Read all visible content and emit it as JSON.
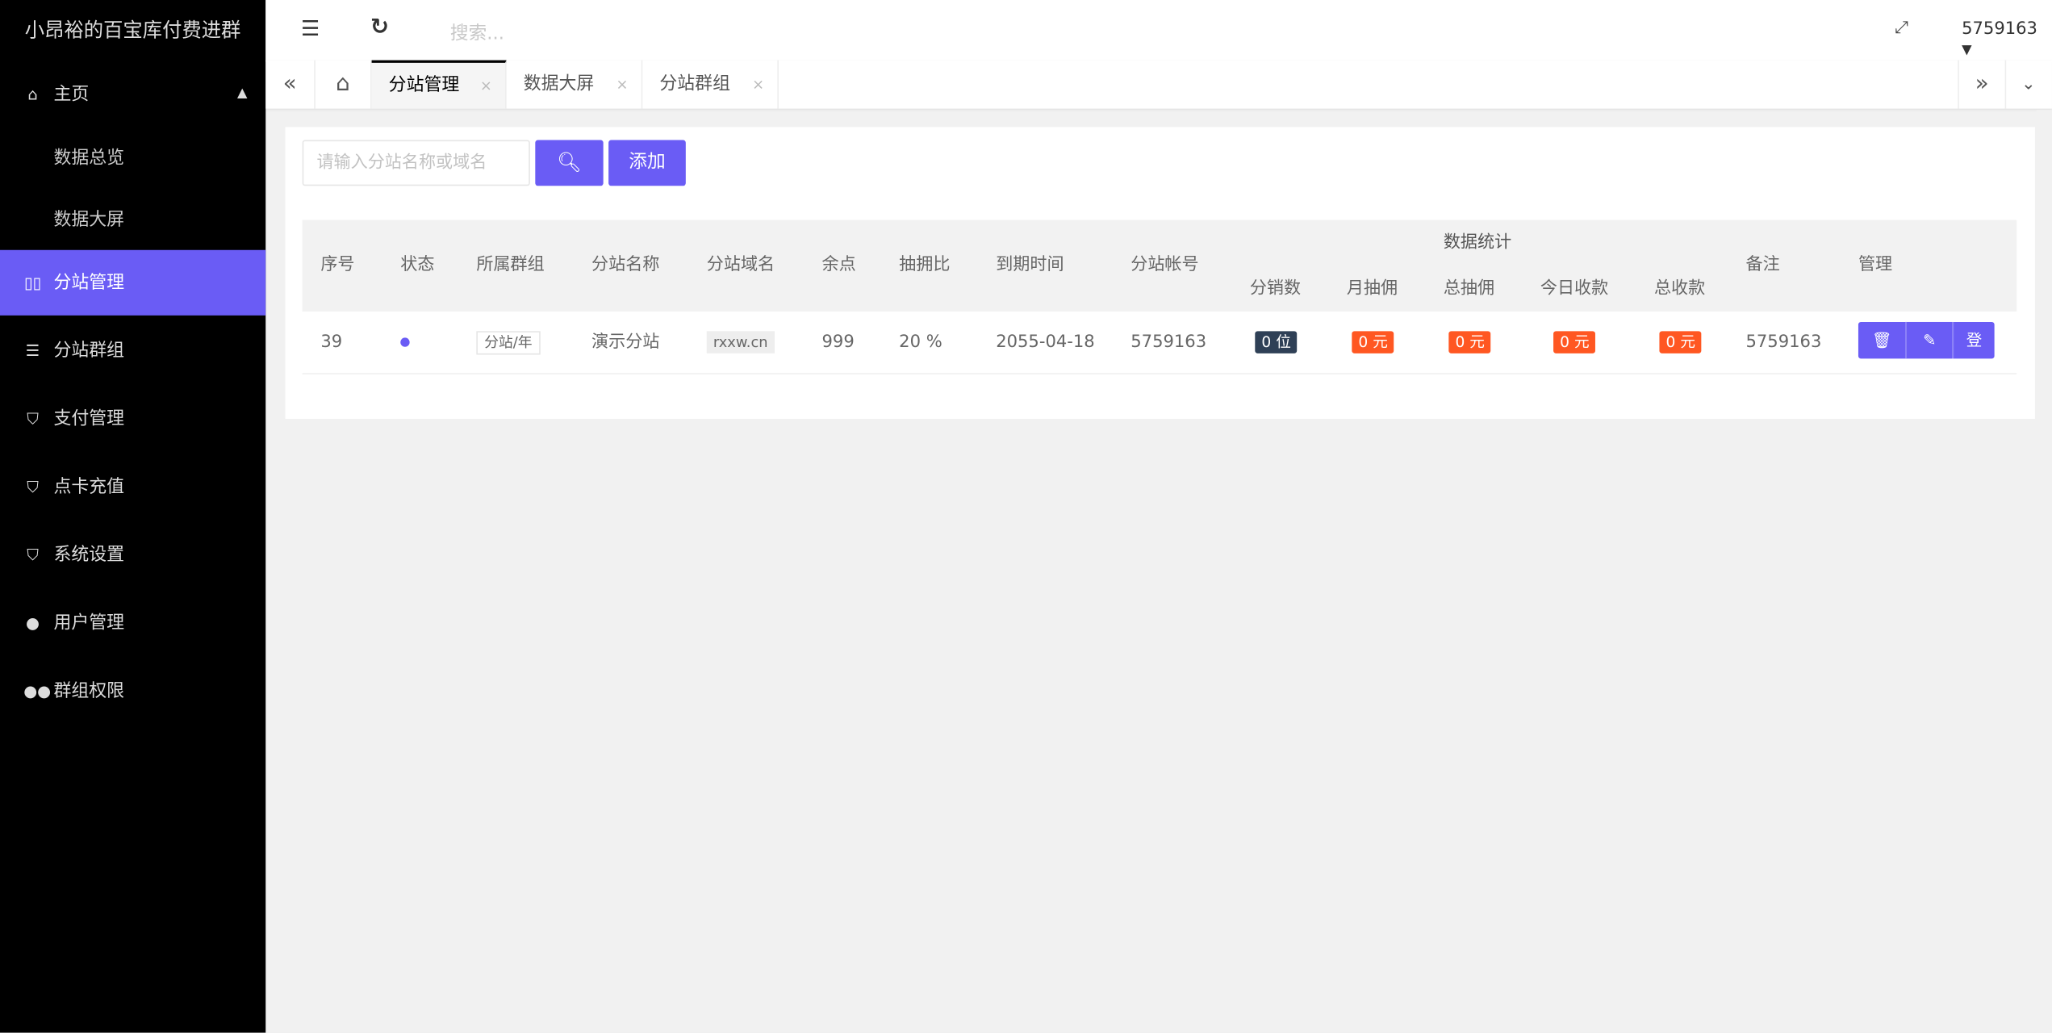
{
  "brand": "小昂裕的百宝库付费进群",
  "sidebar": {
    "items": [
      {
        "label": "主页",
        "icon": "home-icon",
        "expanded": true
      },
      {
        "label": "数据总览"
      },
      {
        "label": "数据大屏"
      },
      {
        "label": "分站管理",
        "icon": "columns-icon",
        "active": true
      },
      {
        "label": "分站群组",
        "icon": "sliders-icon"
      },
      {
        "label": "支付管理",
        "icon": "shield-icon"
      },
      {
        "label": "点卡充值",
        "icon": "shield-icon"
      },
      {
        "label": "系统设置",
        "icon": "shield-icon"
      },
      {
        "label": "用户管理",
        "icon": "user-icon"
      },
      {
        "label": "群组权限",
        "icon": "users-icon"
      }
    ]
  },
  "header": {
    "search_placeholder": "搜索...",
    "user": "5759163"
  },
  "tabs": [
    {
      "label": "分站管理",
      "active": true
    },
    {
      "label": "数据大屏"
    },
    {
      "label": "分站群组"
    }
  ],
  "toolbar": {
    "search_placeholder": "请输入分站名称或域名",
    "add_label": "添加"
  },
  "table": {
    "headers": {
      "no": "序号",
      "status": "状态",
      "group": "所属群组",
      "name": "分站名称",
      "domain": "分站域名",
      "points": "余点",
      "ratio": "抽拥比",
      "expire": "到期时间",
      "account": "分站帐号",
      "stats": "数据统计",
      "sales": "分销数",
      "month": "月抽佣",
      "total": "总抽佣",
      "today": "今日收款",
      "income": "总收款",
      "remark": "备注",
      "manage": "管理"
    },
    "rows": [
      {
        "no": "39",
        "status_color": "#6a5cf5",
        "group": "分站/年",
        "name": "演示分站",
        "domain": "rxxw.cn",
        "points": "999",
        "ratio": "20 %",
        "expire": "2055-04-18",
        "account": "5759163",
        "sales": "0 位",
        "month": "0 元",
        "total": "0 元",
        "today": "0 元",
        "income": "0 元",
        "remark": "5759163",
        "actions": {
          "delete": "delete-icon",
          "edit": "edit-icon",
          "login": "登"
        }
      }
    ]
  },
  "colors": {
    "accent": "#6a5cf5",
    "orange": "#ff5722",
    "dark": "#2f4056"
  }
}
